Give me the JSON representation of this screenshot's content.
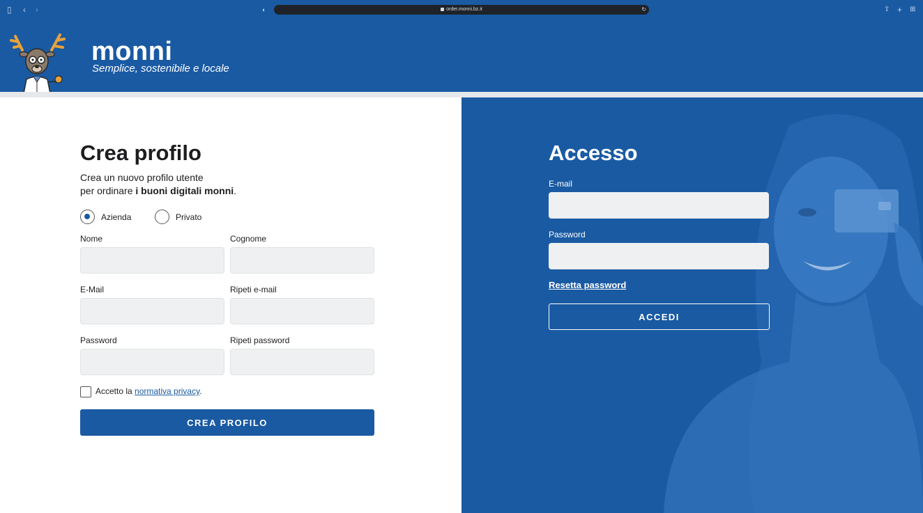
{
  "browser": {
    "url": "order.monni.bz.it"
  },
  "header": {
    "brand": "monni",
    "tagline": "Semplice, sostenibile e locale"
  },
  "register": {
    "title": "Crea profilo",
    "intro_line1": "Crea un nuovo profilo utente",
    "intro_line2_prefix": "per ordinare ",
    "intro_line2_bold": "i buoni digitali monni",
    "intro_line2_suffix": ".",
    "radio_company": "Azienda",
    "radio_private": "Privato",
    "selected_type": "Azienda",
    "first_name_label": "Nome",
    "last_name_label": "Cognome",
    "email_label": "E-Mail",
    "repeat_email_label": "Ripeti e-mail",
    "password_label": "Password",
    "repeat_password_label": "Ripeti password",
    "privacy_prefix": "Accetto la ",
    "privacy_link": "normativa privacy",
    "privacy_suffix": ".",
    "submit": "CREA PROFILO"
  },
  "login": {
    "title": "Accesso",
    "email_label": "E-mail",
    "password_label": "Password",
    "reset_link": "Resetta password",
    "submit": "ACCEDI"
  },
  "colors": {
    "brand_blue": "#1a5aa3",
    "input_bg": "#eef0f1"
  }
}
